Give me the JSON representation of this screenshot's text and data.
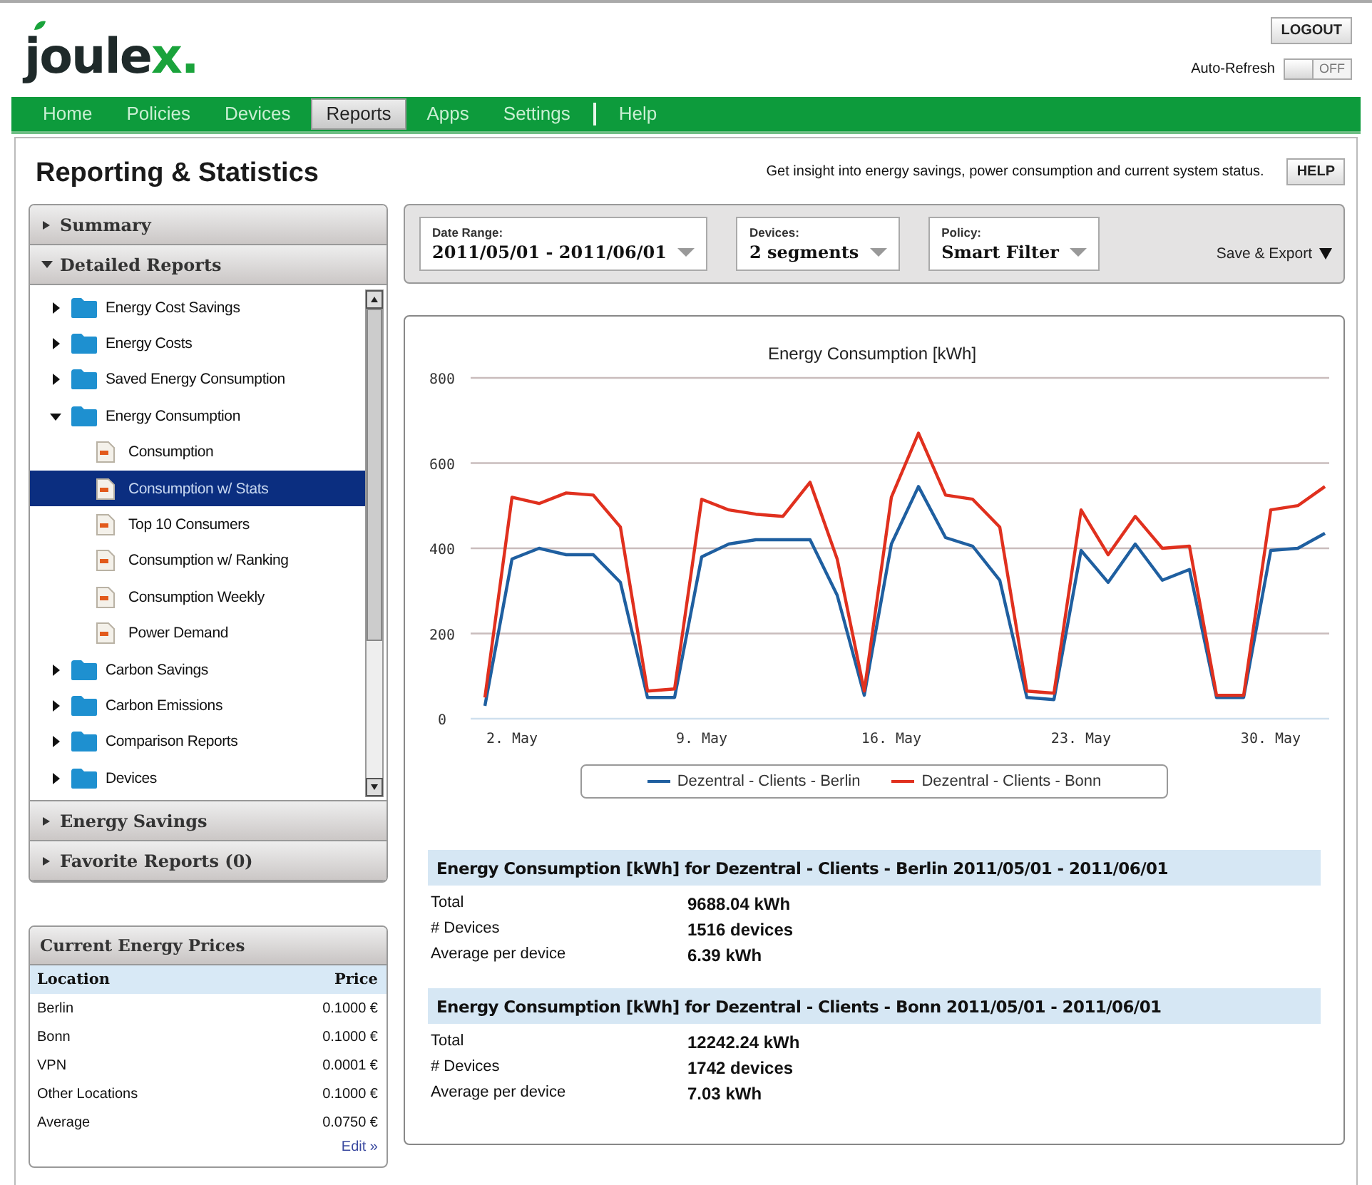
{
  "header": {
    "logo": {
      "text": "joule",
      "accent": "x."
    },
    "logout": "LOGOUT",
    "auto_refresh": {
      "label": "Auto-Refresh",
      "state": "OFF",
      "on": false
    }
  },
  "nav": [
    {
      "label": "Home",
      "selected": false
    },
    {
      "label": "Policies",
      "selected": false
    },
    {
      "label": "Devices",
      "selected": false
    },
    {
      "label": "Reports",
      "selected": true
    },
    {
      "label": "Apps",
      "selected": false
    },
    {
      "label": "Settings",
      "selected": false
    },
    {
      "label": "Help",
      "selected": false
    }
  ],
  "page": {
    "title": "Reporting & Statistics",
    "subtitle": "Get insight into energy savings, power consumption and current system status.",
    "help": "HELP"
  },
  "sidebar": {
    "sections": [
      {
        "title": "Summary",
        "expanded": false
      },
      {
        "title": "Detailed Reports",
        "expanded": true,
        "tree": [
          {
            "label": "Energy Cost Savings",
            "kind": "folder",
            "expanded": false,
            "selected": false
          },
          {
            "label": "Energy Costs",
            "kind": "folder",
            "expanded": false,
            "selected": false
          },
          {
            "label": "Saved Energy Consumption",
            "kind": "folder",
            "expanded": false,
            "selected": false
          },
          {
            "label": "Energy Consumption",
            "kind": "folder",
            "expanded": true,
            "selected": false,
            "children": [
              {
                "label": "Consumption",
                "kind": "report",
                "selected": false
              },
              {
                "label": "Consumption w/ Stats",
                "kind": "report",
                "selected": true
              },
              {
                "label": "Top 10 Consumers",
                "kind": "report",
                "selected": false
              },
              {
                "label": "Consumption w/ Ranking",
                "kind": "report",
                "selected": false
              },
              {
                "label": "Consumption Weekly",
                "kind": "report",
                "selected": false
              },
              {
                "label": "Power Demand",
                "kind": "report",
                "selected": false
              }
            ]
          },
          {
            "label": "Carbon Savings",
            "kind": "folder",
            "expanded": false,
            "selected": false
          },
          {
            "label": "Carbon Emissions",
            "kind": "folder",
            "expanded": false,
            "selected": false
          },
          {
            "label": "Comparison Reports",
            "kind": "folder",
            "expanded": false,
            "selected": false
          },
          {
            "label": "Devices",
            "kind": "folder",
            "expanded": false,
            "selected": false
          }
        ]
      },
      {
        "title": "Energy Savings",
        "expanded": false
      },
      {
        "title": "Favorite Reports (0)",
        "expanded": false
      }
    ],
    "prices": {
      "title": "Current Energy Prices",
      "columns": [
        "Location",
        "Price"
      ],
      "rows": [
        [
          "Berlin",
          "0.1000 €"
        ],
        [
          "Bonn",
          "0.1000 €"
        ],
        [
          "VPN",
          "0.0001 €"
        ],
        [
          "Other Locations",
          "0.1000 €"
        ],
        [
          "Average",
          "0.0750 €"
        ]
      ],
      "edit": "Edit »"
    }
  },
  "filters": [
    {
      "label": "Date Range:",
      "value": "2011/05/01 - 2011/06/01"
    },
    {
      "label": "Devices:",
      "value": "2 segments"
    },
    {
      "label": "Policy:",
      "value": "Smart Filter"
    }
  ],
  "save_export": "Save & Export",
  "chart_data": {
    "type": "line",
    "title": "Energy Consumption [kWh]",
    "categories": [
      null,
      "2. May",
      null,
      null,
      null,
      null,
      null,
      null,
      "9. May",
      null,
      null,
      null,
      null,
      null,
      null,
      "16. May",
      null,
      null,
      null,
      null,
      null,
      null,
      "23. May",
      null,
      null,
      null,
      null,
      null,
      null,
      "30. May",
      null,
      null
    ],
    "series": [
      {
        "name": "Dezentral - Clients - Berlin",
        "color": "#1f5fa0",
        "values": [
          30,
          375,
          400,
          385,
          385,
          320,
          50,
          50,
          380,
          410,
          420,
          420,
          420,
          290,
          55,
          410,
          545,
          425,
          405,
          325,
          50,
          45,
          395,
          320,
          410,
          325,
          350,
          50,
          50,
          395,
          400,
          435
        ]
      },
      {
        "name": "Dezentral - Clients - Bonn",
        "color": "#e0301e",
        "values": [
          50,
          520,
          505,
          530,
          525,
          450,
          65,
          70,
          515,
          490,
          480,
          475,
          555,
          375,
          65,
          520,
          670,
          525,
          515,
          450,
          65,
          60,
          490,
          385,
          475,
          400,
          405,
          55,
          55,
          490,
          500,
          545
        ]
      }
    ],
    "ylim": [
      0,
      800
    ],
    "yticks": [
      0,
      200,
      400,
      600,
      800
    ],
    "grid": true,
    "legend": "bottom"
  },
  "stats": [
    {
      "title": "Energy Consumption [kWh] for Dezentral - Clients - Berlin 2011/05/01 - 2011/06/01",
      "rows": [
        [
          "Total",
          "9688.04 kWh"
        ],
        [
          "# Devices",
          "1516 devices"
        ],
        [
          "Average per device",
          "6.39 kWh"
        ]
      ]
    },
    {
      "title": "Energy Consumption [kWh] for Dezentral - Clients - Bonn 2011/05/01 - 2011/06/01",
      "rows": [
        [
          "Total",
          "12242.24 kWh"
        ],
        [
          "# Devices",
          "1742 devices"
        ],
        [
          "Average per device",
          "7.03 kWh"
        ]
      ]
    }
  ]
}
